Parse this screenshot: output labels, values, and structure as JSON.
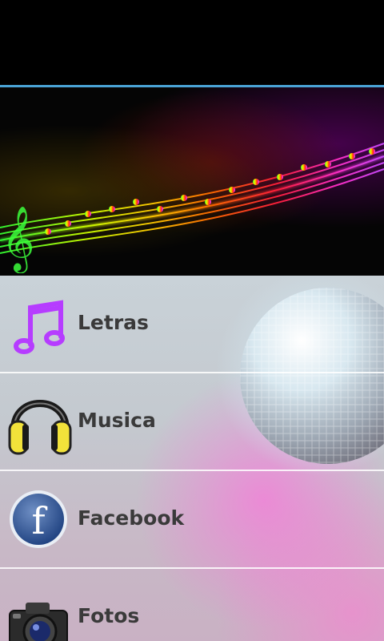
{
  "menu": {
    "items": [
      {
        "label": "Letras",
        "icon": "music-note-icon"
      },
      {
        "label": "Musica",
        "icon": "headphones-icon"
      },
      {
        "label": "Facebook",
        "icon": "facebook-icon"
      },
      {
        "label": "Fotos",
        "icon": "camera-icon"
      }
    ]
  },
  "colors": {
    "accent_line": "#4aa3d6",
    "label_text": "#3a3a3a",
    "divider": "#ffffff"
  }
}
